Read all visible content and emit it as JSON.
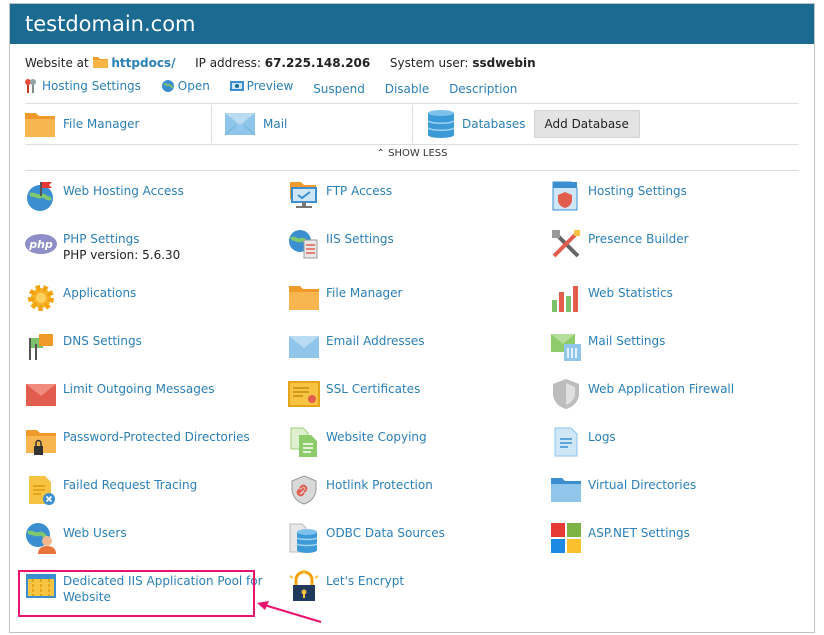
{
  "title": "testdomain.com",
  "info": {
    "website_at_label": "Website at",
    "docroot": "httpdocs/",
    "ip_label": "IP address:",
    "ip_value": "67.225.148.206",
    "user_label": "System user:",
    "user_value": "ssdwebin"
  },
  "actions": [
    "Hosting Settings",
    "Open",
    "Preview",
    "Suspend",
    "Disable",
    "Description"
  ],
  "quick": {
    "file_manager": "File Manager",
    "mail": "Mail",
    "databases": "Databases",
    "add_database": "Add Database"
  },
  "show_less": "SHOW LESS",
  "tools": {
    "col1": [
      {
        "name": "Web Hosting Access",
        "icon": "globe-flag-icon"
      },
      {
        "name": "PHP Settings",
        "sub": "PHP version: 5.6.30",
        "icon": "php-icon"
      },
      {
        "name": "Applications",
        "icon": "gear-icon"
      },
      {
        "name": "DNS Settings",
        "icon": "dns-flags-icon"
      },
      {
        "name": "Limit Outgoing Messages",
        "icon": "envelope-icon"
      },
      {
        "name": "Password-Protected Directories",
        "icon": "folder-lock-icon"
      },
      {
        "name": "Failed Request Tracing",
        "icon": "document-error-icon"
      },
      {
        "name": "Web Users",
        "icon": "globe-user-icon"
      },
      {
        "name": "Dedicated IIS Application Pool for Website",
        "icon": "app-pool-icon"
      }
    ],
    "col2": [
      {
        "name": "FTP Access",
        "icon": "ftp-monitor-icon"
      },
      {
        "name": "IIS Settings",
        "icon": "globe-server-icon"
      },
      {
        "name": "File Manager",
        "icon": "folder-icon"
      },
      {
        "name": "Email Addresses",
        "icon": "envelope-icon"
      },
      {
        "name": "SSL Certificates",
        "icon": "certificate-icon"
      },
      {
        "name": "Website Copying",
        "icon": "copy-icon"
      },
      {
        "name": "Hotlink Protection",
        "icon": "shield-link-icon"
      },
      {
        "name": "ODBC Data Sources",
        "icon": "database-icon"
      },
      {
        "name": "Let's Encrypt",
        "icon": "lock-icon"
      }
    ],
    "col3": [
      {
        "name": "Hosting Settings",
        "icon": "document-shield-icon"
      },
      {
        "name": "Presence Builder",
        "icon": "tools-icon"
      },
      {
        "name": "Web Statistics",
        "icon": "bar-chart-icon"
      },
      {
        "name": "Mail Settings",
        "icon": "mail-settings-icon"
      },
      {
        "name": "Web Application Firewall",
        "icon": "shield-icon"
      },
      {
        "name": "Logs",
        "icon": "document-icon"
      },
      {
        "name": "Virtual Directories",
        "icon": "folder-open-icon"
      },
      {
        "name": "ASP.NET Settings",
        "icon": "windows-icon"
      }
    ]
  },
  "colors": {
    "header": "#1a6a92",
    "link": "#2b7fb7",
    "highlight": "#e8136f"
  }
}
